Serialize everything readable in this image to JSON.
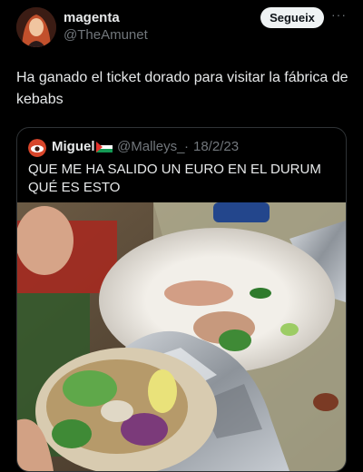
{
  "author": {
    "name": "magenta",
    "handle": "@TheAmunet",
    "follow_label": "Segueix",
    "more_label": "···"
  },
  "tweet": {
    "text": "Ha ganado el ticket dorado para visitar la fábrica de kebabs"
  },
  "quoted": {
    "name": "Miguel",
    "handle": "@Malleys_",
    "separator": "·",
    "date": "18/2/23",
    "text": "QUE ME HA SALIDO UN EURO EN EL DURUM QUÉ ES ESTO",
    "image": "photo of a durum wrap in aluminium foil on a plate"
  }
}
